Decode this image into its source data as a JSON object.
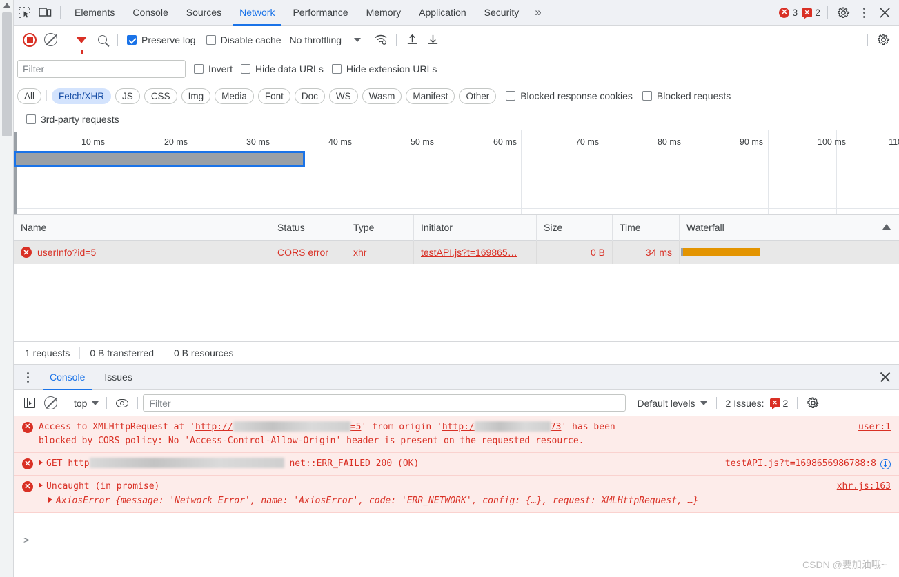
{
  "devtools": {
    "tabs": [
      {
        "label": "Elements",
        "active": false
      },
      {
        "label": "Console",
        "active": false
      },
      {
        "label": "Sources",
        "active": false
      },
      {
        "label": "Network",
        "active": true
      },
      {
        "label": "Performance",
        "active": false
      },
      {
        "label": "Memory",
        "active": false
      },
      {
        "label": "Application",
        "active": false
      },
      {
        "label": "Security",
        "active": false
      }
    ],
    "more_tabs_label": "»",
    "error_count": "3",
    "warning_count": "2",
    "inspect_icon": "inspect-element-icon",
    "device_icon": "device-toolbar-icon",
    "settings_icon": "gear-icon",
    "menu_icon": "kebab-menu-icon",
    "close_icon": "close-icon"
  },
  "network_toolbar": {
    "record_icon": "record-stop-icon",
    "clear_icon": "clear-icon",
    "filter_icon": "filter-funnel-icon",
    "search_icon": "search-icon",
    "preserve_log": {
      "label": "Preserve log",
      "checked": true
    },
    "disable_cache": {
      "label": "Disable cache",
      "checked": false
    },
    "throttling": "No throttling",
    "wifi_icon": "network-conditions-icon",
    "import_icon": "import-har-icon",
    "export_icon": "export-har-icon",
    "settings_icon": "network-settings-gear-icon"
  },
  "filters": {
    "placeholder": "Filter",
    "value": "",
    "invert": {
      "label": "Invert",
      "checked": false
    },
    "hide_data_urls": {
      "label": "Hide data URLs",
      "checked": false
    },
    "hide_extension_urls": {
      "label": "Hide extension URLs",
      "checked": false
    },
    "blocked_response_cookies": {
      "label": "Blocked response cookies",
      "checked": false
    },
    "blocked_requests": {
      "label": "Blocked requests",
      "checked": false
    },
    "third_party_requests": {
      "label": "3rd-party requests",
      "checked": false
    },
    "types": [
      {
        "label": "All",
        "active": false
      },
      {
        "label": "Fetch/XHR",
        "active": true
      },
      {
        "label": "JS",
        "active": false
      },
      {
        "label": "CSS",
        "active": false
      },
      {
        "label": "Img",
        "active": false
      },
      {
        "label": "Media",
        "active": false
      },
      {
        "label": "Font",
        "active": false
      },
      {
        "label": "Doc",
        "active": false
      },
      {
        "label": "WS",
        "active": false
      },
      {
        "label": "Wasm",
        "active": false
      },
      {
        "label": "Manifest",
        "active": false
      },
      {
        "label": "Other",
        "active": false
      }
    ]
  },
  "overview": {
    "ticks": [
      "10 ms",
      "20 ms",
      "30 ms",
      "40 ms",
      "50 ms",
      "60 ms",
      "70 ms",
      "80 ms",
      "90 ms",
      "100 ms",
      "110"
    ],
    "selection_color": "#1a73e8",
    "band_color": "#9aa0a6"
  },
  "requests_table": {
    "columns": [
      "Name",
      "Status",
      "Type",
      "Initiator",
      "Size",
      "Time",
      "Waterfall"
    ],
    "rows": [
      {
        "name": "userInfo?id=5",
        "status": "CORS error",
        "type": "xhr",
        "initiator": "testAPI.js?t=169865…",
        "size": "0 B",
        "time": "34 ms",
        "waterfall_color": "#e39400"
      }
    ]
  },
  "summary": {
    "requests": "1 requests",
    "transferred": "0 B transferred",
    "resources": "0 B resources"
  },
  "drawer": {
    "tabs": [
      {
        "label": "Console",
        "active": true
      },
      {
        "label": "Issues",
        "active": false
      }
    ],
    "console_toolbar": {
      "sidebar_icon": "console-sidebar-icon",
      "clear_icon": "clear-console-icon",
      "context": "top",
      "eye_icon": "live-expression-icon",
      "filter_placeholder": "Filter",
      "filter_value": "",
      "levels": "Default levels",
      "issues_label": "2 Issues:",
      "issues_count": "2",
      "settings_icon": "console-settings-gear-icon"
    },
    "messages": [
      {
        "line1_a": "Access to XMLHttpRequest at '",
        "line1_url_prefix": "http://",
        "line1_url_suffix": "=5",
        "line1_b": "' from origin '",
        "line2_url_prefix": "http:/",
        "line2_url_suffix": "73",
        "line1_c": "' has been",
        "line2": "blocked by CORS policy: No 'Access-Control-Allow-Origin' header is present on the requested resource.",
        "source": "user:1"
      },
      {
        "method": "GET",
        "url_prefix": "http",
        "tail": "net::ERR_FAILED 200 (OK)",
        "source": "testAPI.js?t=1698656986788:8",
        "has_info_icon": true
      },
      {
        "line1": "Uncaught (in promise)",
        "line2": "AxiosError {message: 'Network Error', name: 'AxiosError', code: 'ERR_NETWORK', config: {…}, request: XMLHttpRequest, …}",
        "source": "xhr.js:163"
      }
    ],
    "prompt": ">"
  },
  "watermark": "CSDN @要加油哦~"
}
